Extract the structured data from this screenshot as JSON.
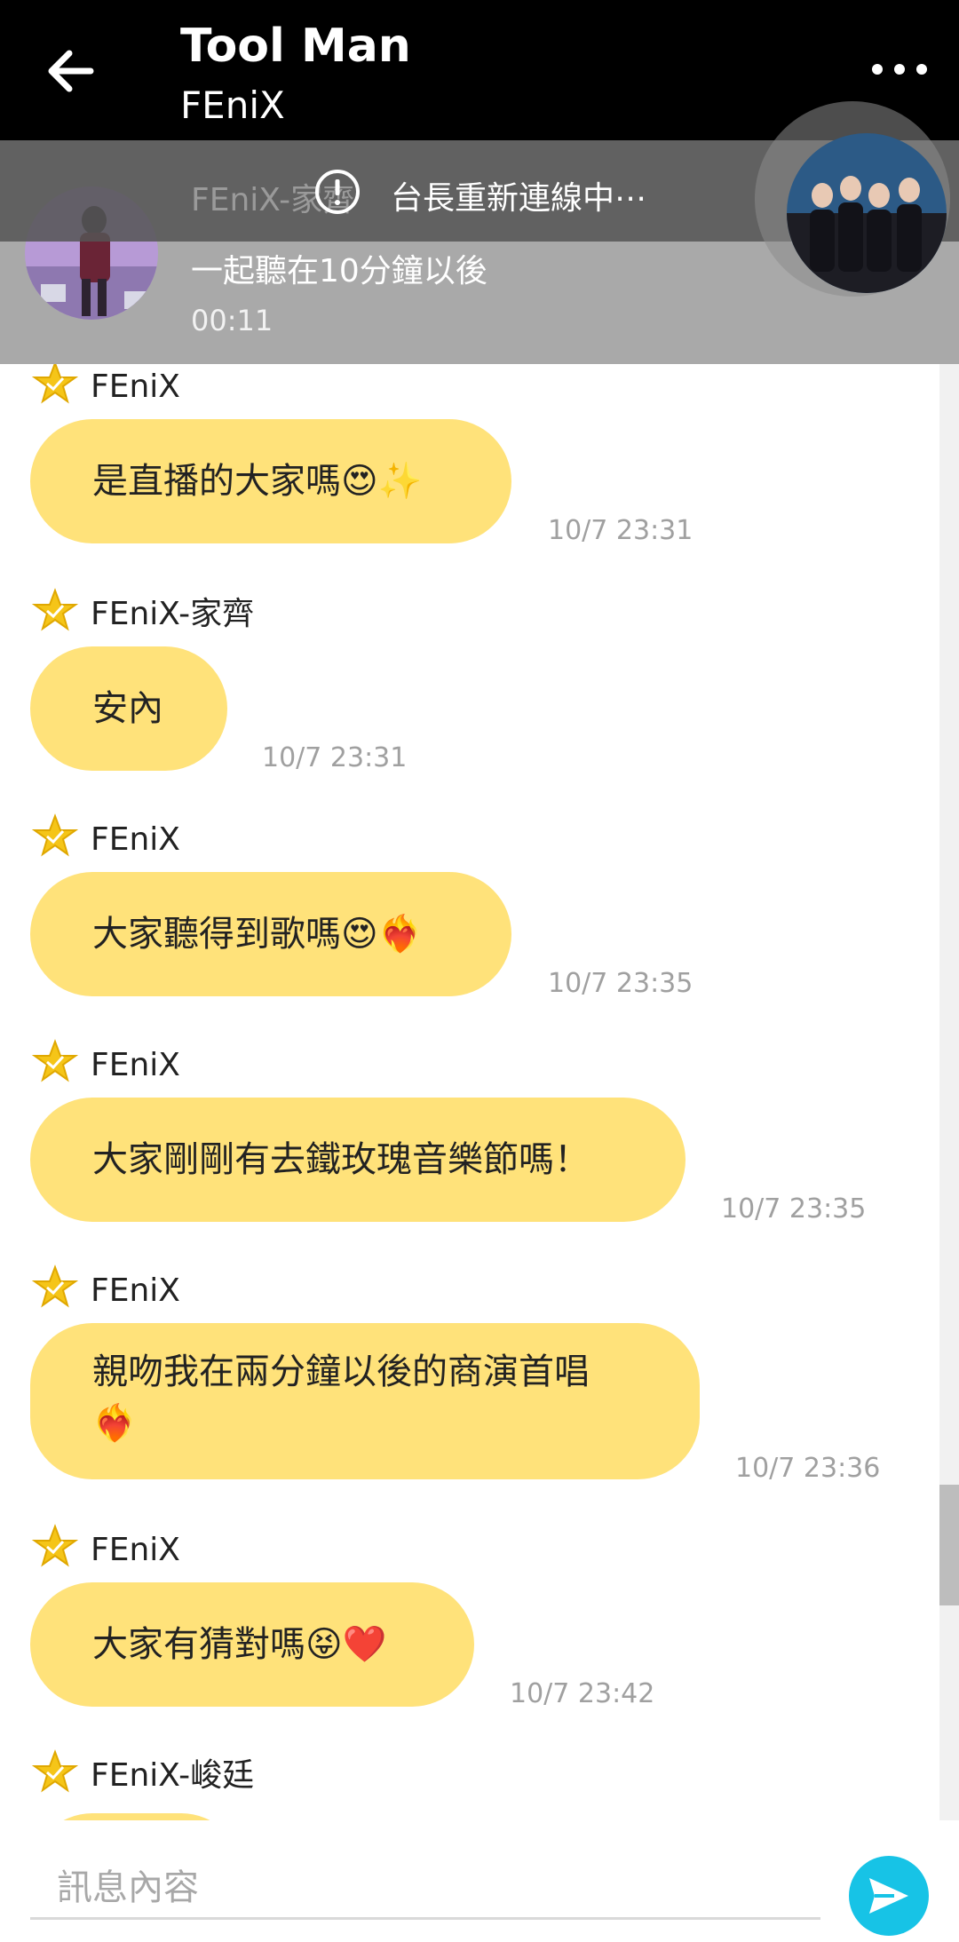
{
  "header": {
    "title": "Tool Man",
    "subtitle": "FEniX"
  },
  "now_playing": {
    "faded_name": "FEniX-家齊",
    "alert_text": "台長重新連線中⋯",
    "description": "一起聽在10分鐘以後",
    "time": "00:11"
  },
  "messages": [
    {
      "sender": "FEniX",
      "text": "是直播的大家嗎😍✨",
      "time": "10/7 23:31"
    },
    {
      "sender": "FEniX-家齊",
      "text": "安內",
      "time": "10/7 23:31"
    },
    {
      "sender": "FEniX",
      "text": "大家聽得到歌嗎😍❤️‍🔥",
      "time": "10/7 23:35"
    },
    {
      "sender": "FEniX",
      "text": "大家剛剛有去鐵玫瑰音樂節嗎！",
      "time": "10/7 23:35"
    },
    {
      "sender": "FEniX",
      "text": "親吻我在兩分鐘以後的商演首唱❤️‍🔥",
      "time": "10/7 23:36"
    },
    {
      "sender": "FEniX",
      "text": "大家有猜對嗎😝❤️",
      "time": "10/7 23:42"
    },
    {
      "sender": "FEniX-峻廷",
      "text": "",
      "time": ""
    }
  ],
  "input": {
    "placeholder": "訊息內容"
  },
  "colors": {
    "bubble": "#ffe27a",
    "header": "#000000",
    "send_button": "#17c3e6",
    "star": "#f5c518"
  },
  "icons": {
    "back": "arrow-left-icon",
    "more": "more-dots-icon",
    "alert": "exclamation-circle-icon",
    "star": "verified-star-icon",
    "send": "send-paper-plane-icon"
  }
}
